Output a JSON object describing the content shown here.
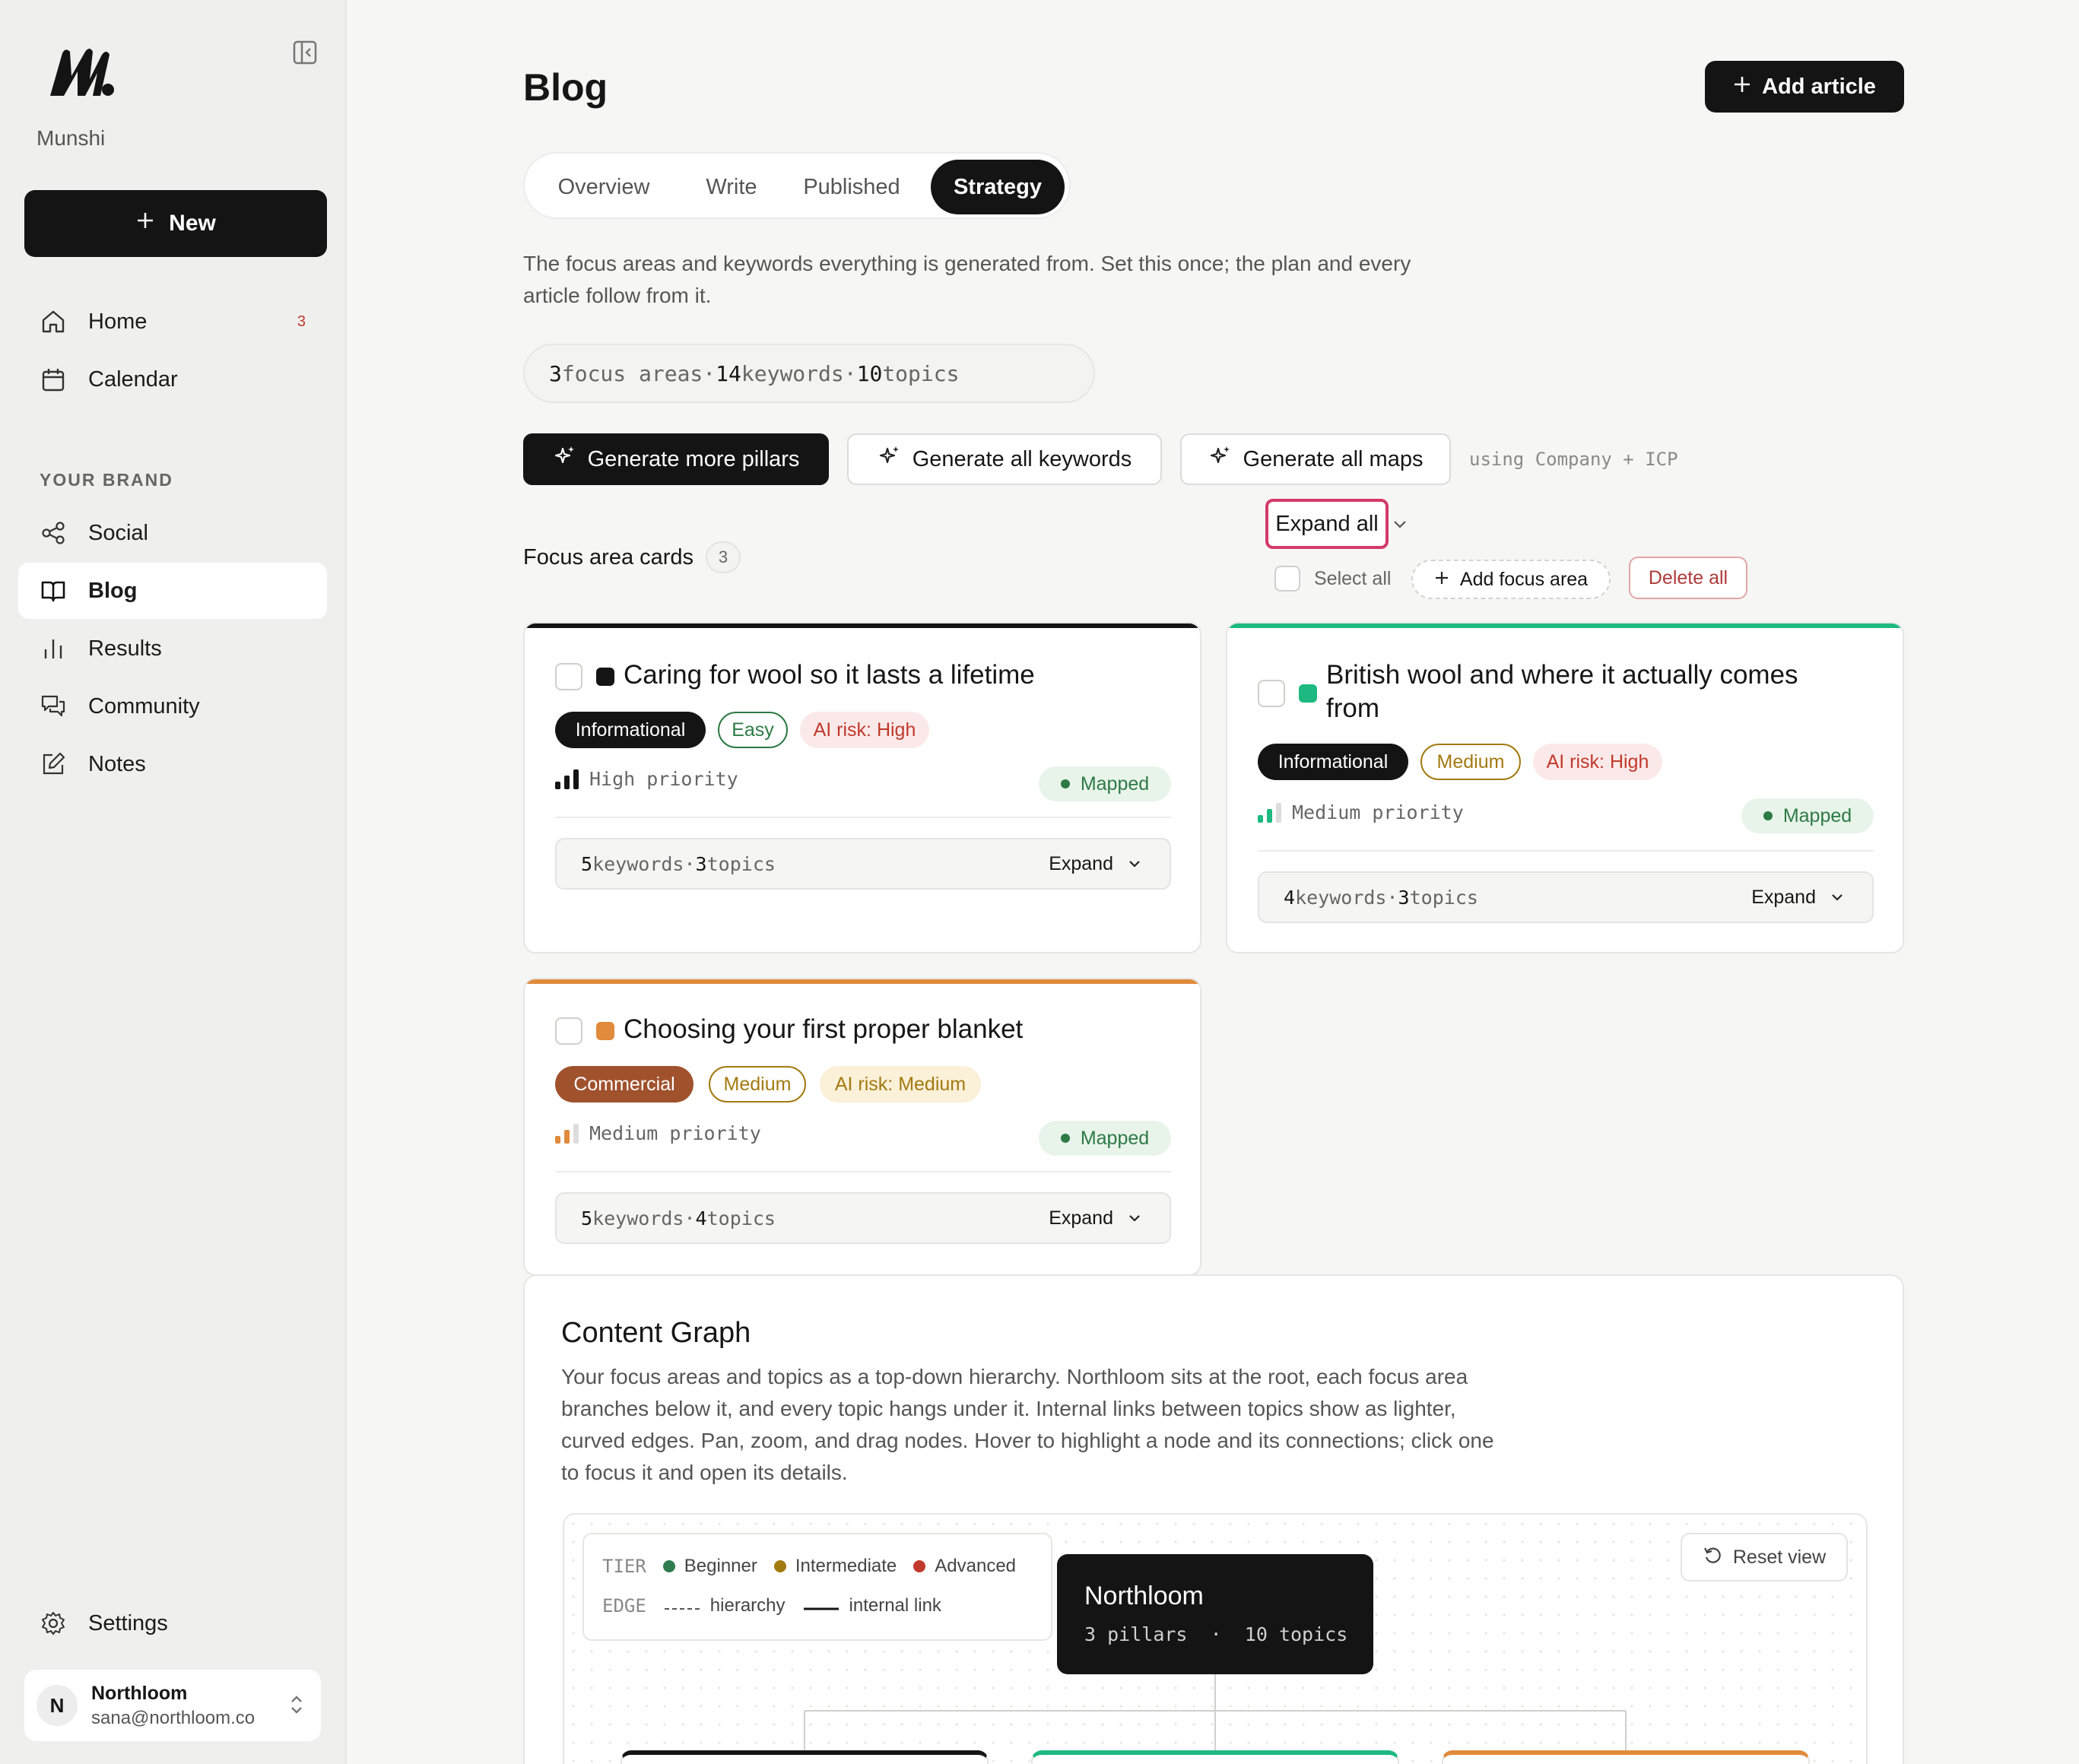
{
  "brand": {
    "name": "Munshi"
  },
  "sidebar": {
    "new_label": "New",
    "nav": [
      {
        "label": "Home",
        "icon": "home-icon",
        "badge": "3"
      },
      {
        "label": "Calendar",
        "icon": "calendar-icon"
      }
    ],
    "section_label": "YOUR BRAND",
    "brand_nav": [
      {
        "label": "Social",
        "icon": "share-icon"
      },
      {
        "label": "Blog",
        "icon": "book-icon",
        "active": true
      },
      {
        "label": "Results",
        "icon": "bar-chart-icon"
      },
      {
        "label": "Community",
        "icon": "chat-icon"
      },
      {
        "label": "Notes",
        "icon": "edit-icon"
      }
    ],
    "settings_label": "Settings",
    "user": {
      "initial": "N",
      "name": "Northloom",
      "email": "sana@northloom.co"
    }
  },
  "header": {
    "title": "Blog",
    "add_article_label": "Add article"
  },
  "tabs": [
    {
      "label": "Overview"
    },
    {
      "label": "Write"
    },
    {
      "label": "Published"
    },
    {
      "label": "Strategy",
      "active": true
    }
  ],
  "intro": "The focus areas and keywords everything is generated from. Set this once; the plan and every article follow from it.",
  "stats": {
    "focus_areas": "3",
    "focus_areas_label": "focus areas",
    "keywords": "14",
    "keywords_label": "keywords",
    "topics": "10",
    "topics_label": "topics",
    "separator": "·"
  },
  "actions": {
    "generate_pillars": "Generate more pillars",
    "generate_keywords": "Generate all keywords",
    "generate_maps": "Generate all maps",
    "using_note": "using Company + ICP"
  },
  "focus_section": {
    "heading": "Focus area cards",
    "count": "3",
    "expand_all": "Expand all",
    "select_all": "Select all",
    "add_focus_area": "Add focus area",
    "delete_all": "Delete all"
  },
  "cards": [
    {
      "title": "Caring for wool so it lasts a lifetime",
      "accent": "#141414",
      "intent": "Informational",
      "difficulty": "Easy",
      "ai_risk": "AI risk: High",
      "priority": "High priority",
      "priority_level": 3,
      "status": "Mapped",
      "keywords_count": "5",
      "keywords_label": "keywords",
      "topics_count": "3",
      "topics_label": "topics",
      "expand_label": "Expand"
    },
    {
      "title": "British wool and where it actually comes from",
      "accent": "#1db980",
      "intent": "Informational",
      "difficulty": "Medium",
      "ai_risk": "AI risk: High",
      "priority": "Medium priority",
      "priority_level": 2,
      "status": "Mapped",
      "keywords_count": "4",
      "keywords_label": "keywords",
      "topics_count": "3",
      "topics_label": "topics",
      "expand_label": "Expand"
    },
    {
      "title": "Choosing your first proper blanket",
      "accent": "#e08a3c",
      "intent": "Commercial",
      "difficulty": "Medium",
      "ai_risk": "AI risk: Medium",
      "priority": "Medium priority",
      "priority_level": 2,
      "status": "Mapped",
      "keywords_count": "5",
      "keywords_label": "keywords",
      "topics_count": "4",
      "topics_label": "topics",
      "expand_label": "Expand"
    }
  ],
  "graph": {
    "title": "Content Graph",
    "description": "Your focus areas and topics as a top-down hierarchy. Northloom sits at the root, each focus area branches below it, and every topic hangs under it. Internal links between topics show as lighter, curved edges. Pan, zoom, and drag nodes. Hover to highlight a node and its connections; click one to focus it and open its details.",
    "legend": {
      "tier_label": "TIER",
      "tiers": [
        {
          "label": "Beginner",
          "color": "#2e7d4f"
        },
        {
          "label": "Intermediate",
          "color": "#a37a10"
        },
        {
          "label": "Advanced",
          "color": "#c0392b"
        }
      ],
      "edge_label": "EDGE",
      "edges": [
        {
          "label": "hierarchy",
          "style": "dashed"
        },
        {
          "label": "internal link",
          "style": "solid"
        }
      ]
    },
    "root": {
      "title": "Northloom",
      "pillars": "3",
      "pillars_label": "pillars",
      "topics": "10",
      "topics_label": "topics"
    },
    "reset_label": "Reset view",
    "child_colors": [
      "#141414",
      "#1db980",
      "#e08a3c"
    ]
  }
}
